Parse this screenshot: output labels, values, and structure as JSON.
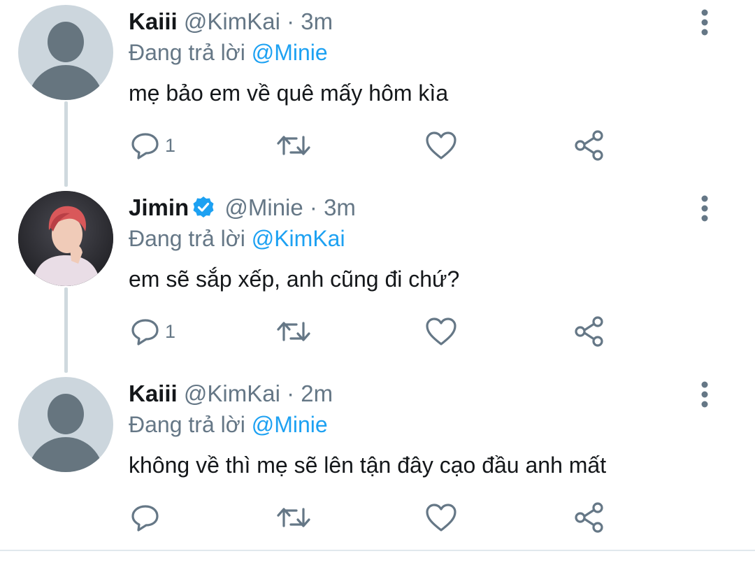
{
  "tweets": [
    {
      "display_name": "Kaiii",
      "handle": "@KimKai",
      "separator": "·",
      "time": "3m",
      "reply_prefix": "Đang trả lời",
      "reply_to": "@Minie",
      "text": "mẹ bảo em về quê mấy hôm kìa",
      "reply_count": "1",
      "verified": false,
      "avatar": "default-avatar-icon"
    },
    {
      "display_name": "Jimin",
      "handle": "@Minie",
      "separator": "·",
      "time": "3m",
      "reply_prefix": "Đang trả lời",
      "reply_to": "@KimKai",
      "text": "em sẽ sắp xếp, anh cũng đi chứ?",
      "reply_count": "1",
      "verified": true,
      "avatar": "profile-photo"
    },
    {
      "display_name": "Kaiii",
      "handle": "@KimKai",
      "separator": "·",
      "time": "2m",
      "reply_prefix": "Đang trả lời",
      "reply_to": "@Minie",
      "text": "không về thì mẹ sẽ lên tận đây cạo đầu anh mất",
      "reply_count": "",
      "verified": false,
      "avatar": "default-avatar-icon"
    }
  ],
  "colors": {
    "link": "#1da1f2",
    "secondary_text": "#657786",
    "icon": "#657786",
    "verified": "#1da1f2",
    "default_avatar_bg": "#ccd6dd"
  }
}
